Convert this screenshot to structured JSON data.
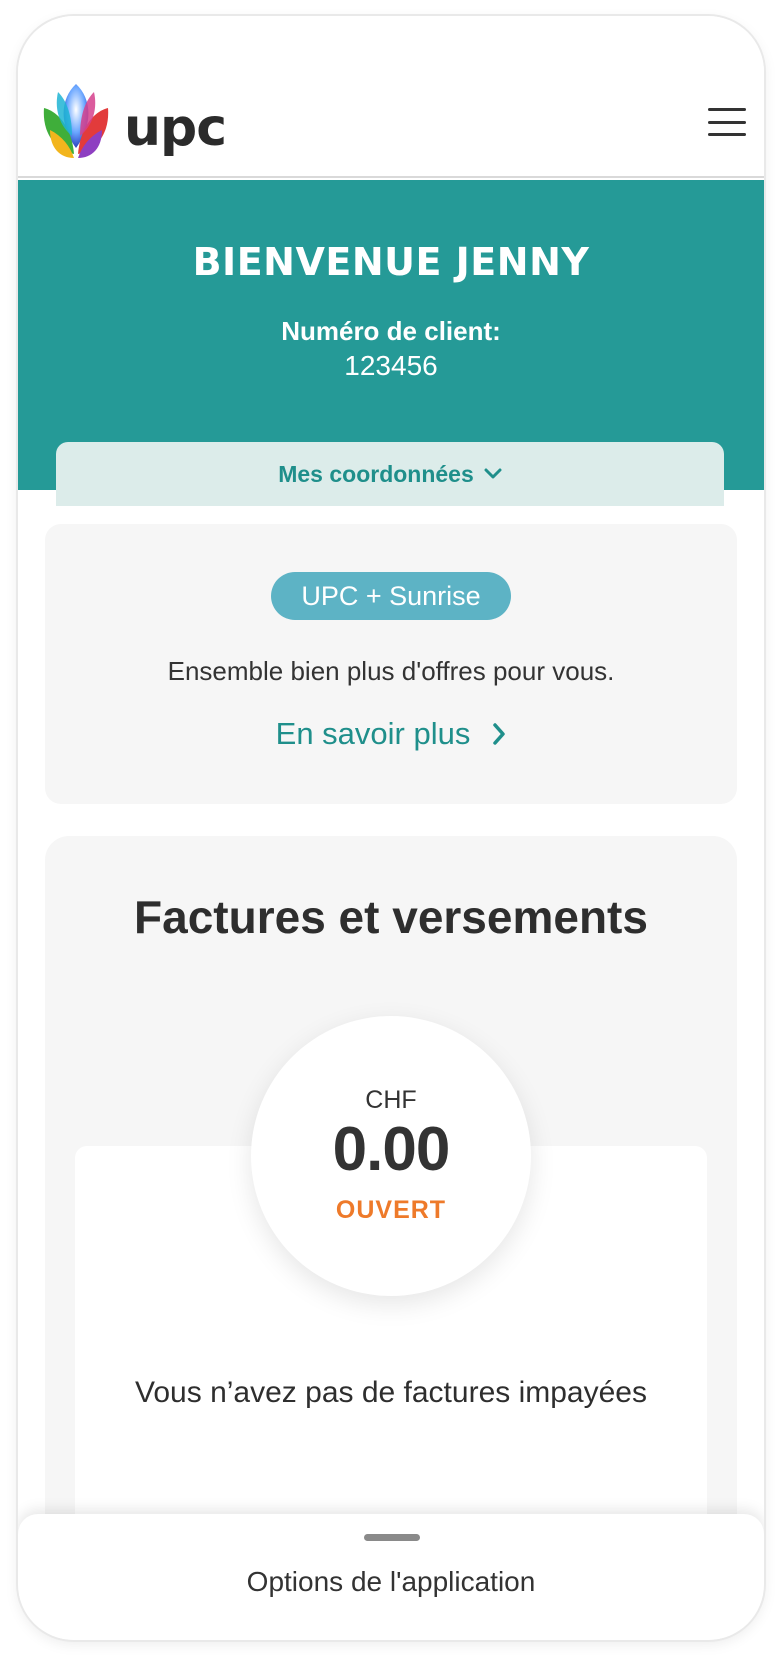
{
  "header": {
    "brand": "upc",
    "menu_icon": "hamburger-icon"
  },
  "welcome": {
    "title": "BIENVENUE JENNY",
    "client_label": "Numéro de client:",
    "client_number": "123456",
    "coord_tab_label": "Mes coordonnées",
    "coord_tab_icon": "chevron-down-icon"
  },
  "promo": {
    "pill": "UPC + Sunrise",
    "text": "Ensemble bien plus d'offres pour vous.",
    "link": "En savoir plus",
    "link_icon": "chevron-right-icon"
  },
  "invoices": {
    "title": "Factures et versements",
    "currency": "CHF",
    "amount": "0.00",
    "status": "OUVERT",
    "message": "Vous n’avez pas de factures impayées"
  },
  "bottom_sheet": {
    "label": "Options de l'application"
  },
  "colors": {
    "teal": "#259a97",
    "teal_text": "#1f8f8b",
    "pill": "#5db3c5",
    "status_orange": "#ee7a2a",
    "card_bg": "#f6f6f6"
  }
}
